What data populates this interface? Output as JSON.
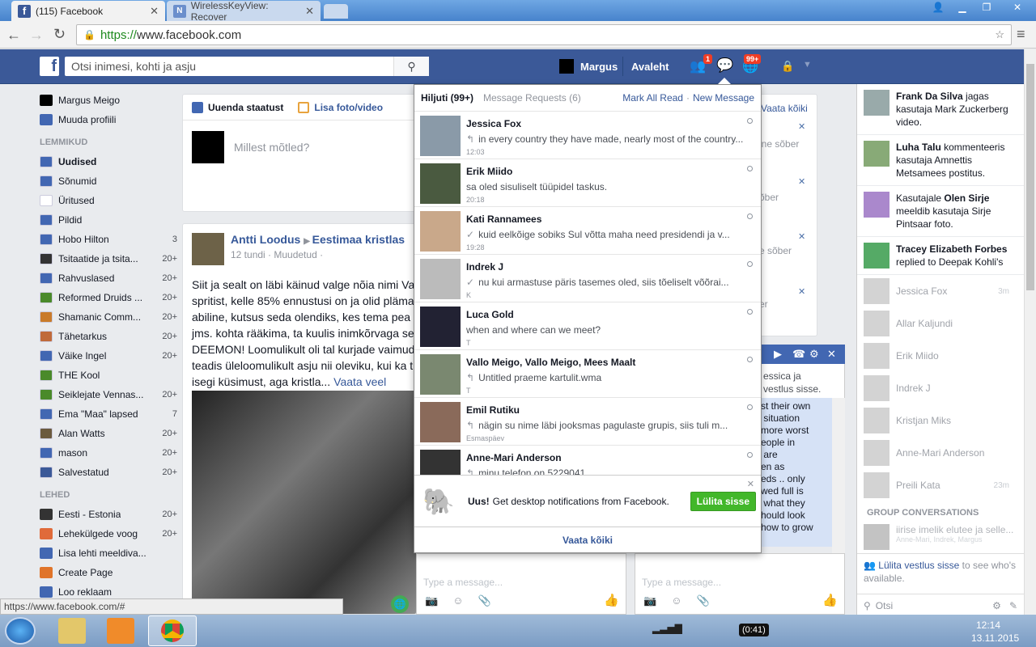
{
  "browser": {
    "tabs": [
      {
        "title": "(115) Facebook",
        "active": true
      },
      {
        "title": "WirelessKeyView: Recover",
        "active": false
      }
    ],
    "url_https": "https://",
    "url_rest": "www.facebook.com",
    "status_url": "https://www.facebook.com/#"
  },
  "header": {
    "search_placeholder": "Otsi inimesi, kohti ja asju",
    "user_name": "Margus",
    "home_label": "Avaleht",
    "friend_requests_badge": "1",
    "notifications_badge": "99+"
  },
  "leftnav": {
    "profile_name": "Margus Meigo",
    "edit_profile": "Muuda profiili",
    "favorites_header": "LEMMIKUD",
    "favorites": [
      {
        "label": "Uudised",
        "count": "",
        "bold": true
      },
      {
        "label": "Sõnumid",
        "count": ""
      },
      {
        "label": "Üritused",
        "count": ""
      },
      {
        "label": "Pildid",
        "count": ""
      },
      {
        "label": "Hobo Hilton",
        "count": "3"
      },
      {
        "label": "Tsitaatide ja tsita...",
        "count": "20+"
      },
      {
        "label": "Rahvuslased",
        "count": "20+"
      },
      {
        "label": "Reformed Druids ...",
        "count": "20+"
      },
      {
        "label": "Shamanic Comm...",
        "count": "20+"
      },
      {
        "label": "Tähetarkus",
        "count": "20+"
      },
      {
        "label": "Väike Ingel",
        "count": "20+"
      },
      {
        "label": "THE Kool",
        "count": ""
      },
      {
        "label": "Seiklejate Vennas...",
        "count": "20+"
      },
      {
        "label": "Ema \"Maa\" lapsed",
        "count": "7"
      },
      {
        "label": "Alan Watts",
        "count": "20+"
      },
      {
        "label": "mason",
        "count": "20+"
      },
      {
        "label": "Salvestatud",
        "count": "20+"
      }
    ],
    "pages_header": "LEHED",
    "pages": [
      {
        "label": "Eesti - Estonia",
        "count": "20+"
      },
      {
        "label": "Lehekülgede voog",
        "count": "20+"
      },
      {
        "label": "Lisa lehti meeldiva...",
        "count": ""
      },
      {
        "label": "Create Page",
        "count": ""
      },
      {
        "label": "Loo reklaam",
        "count": ""
      }
    ]
  },
  "composer": {
    "update_status": "Uuenda staatust",
    "add_photo": "Lisa foto/video",
    "placeholder": "Millest mõtled?"
  },
  "post": {
    "author": "Antti Loodus",
    "target": "Eestimaa kristlas",
    "meta": "12 tundi · Muudetud ·",
    "lines": [
      "Siit ja sealt on läbi käinud valge nõia nimi Va",
      "spritist, kelle 85% ennustusi on ja olid pläma",
      "abiline, kutsus seda olendiks, kes tema pea",
      "jms. kohta rääkima, ta kuulis inimkõrvaga se",
      "DEEMON! Loomulikult oli tal kurjade vaimud",
      "teadis üleloomulikult asju nii oleviku, kui ka t",
      "isegi küsimust, aga kristla..."
    ],
    "see_more": "Vaata veel"
  },
  "suggestions": {
    "see_all": "Vaata kõiki",
    "friend_lines": [
      "ine sõber",
      "õber",
      "e sõber",
      "er"
    ]
  },
  "messages": {
    "tab_inbox": "Hiljuti (99+)",
    "tab_requests": "Message Requests (6)",
    "mark_all_read": "Mark All Read",
    "separator": "·",
    "new_message": "New Message",
    "items": [
      {
        "name": "Jessica Fox",
        "snippet": "in every country they have made, nearly most of the country...",
        "time": "12:03",
        "icon": "reply"
      },
      {
        "name": "Erik Miido",
        "snippet": "sa oled sisuliselt tüüpidel taskus.",
        "time": "20:18",
        "icon": ""
      },
      {
        "name": "Kati Rannamees",
        "snippet": "kuid eelkõige sobiks Sul võtta maha need presidendi ja v...",
        "time": "19:28",
        "icon": "check"
      },
      {
        "name": "Indrek J",
        "snippet": "nu kui armastuse päris tasemes oled, siis tõeliselt võõrai...",
        "time": "K",
        "icon": "check"
      },
      {
        "name": "Luca Gold",
        "snippet": "when and where can we meet?",
        "time": "T",
        "icon": ""
      },
      {
        "name": "Vallo Meigo, Vallo Meigo, Mees Maalt",
        "snippet": "Untitled praeme kartulit.wma",
        "time": "T",
        "icon": "reply"
      },
      {
        "name": "Emil Rutiku",
        "snippet": "nägin su nime läbi jooksmas pagulaste grupis, siis tuli m...",
        "time": "Esmaspäev",
        "icon": "reply"
      },
      {
        "name": "Anne-Mari Anderson",
        "snippet": "minu telefon on 5229041",
        "time": "",
        "icon": "reply"
      }
    ],
    "notify_bold": "Uus!",
    "notify_text": "Get desktop notifications from Facebook.",
    "notify_button": "Lülita sisse",
    "see_all": "Vaata kõiki"
  },
  "chat": {
    "partial_header_lines": [
      "essica ja",
      "vestlus sisse."
    ],
    "partial_lines": [
      "st their own",
      " situation",
      "more worst",
      "eople in",
      " are",
      "en as",
      "eds .. only",
      "wed full is",
      " what they",
      "hould look",
      "how to grow"
    ],
    "type_placeholder": "Type a message..."
  },
  "ticker": {
    "stories": [
      {
        "bold": "Frank Da Silva",
        "text": " jagas kasutaja Mark Zuckerberg video."
      },
      {
        "bold": "Luha Talu",
        "text": " kommenteeris kasutaja Amnettis Metsamees postitus."
      },
      {
        "bold": "",
        "text": "Kasutajale ",
        "bold2": "Olen Sirje",
        "text2": " meeldib kasutaja Sirje Pintsaar foto."
      },
      {
        "bold": "Tracey Elizabeth Forbes",
        "text": " replied to Deepak Kohli's"
      }
    ],
    "friends": [
      {
        "name": "Jessica Fox",
        "time": "3m"
      },
      {
        "name": "Allar Kaljundi",
        "time": ""
      },
      {
        "name": "Erik Miido",
        "time": ""
      },
      {
        "name": "Indrek J",
        "time": ""
      },
      {
        "name": "Kristjan Miks",
        "time": ""
      },
      {
        "name": "Anne-Mari Anderson",
        "time": ""
      },
      {
        "name": "Preili Kata",
        "time": "23m"
      }
    ],
    "group_header": "GROUP CONVERSATIONS",
    "group_title": "iirise imelik elutee ja selle...",
    "group_members": "Anne-Mari, Indrek, Margus",
    "chat_on_link": "Lülita vestlus sisse",
    "chat_on_text": " to see who's available.",
    "search_placeholder": "Otsi"
  },
  "taskbar": {
    "battery": "(0:41)",
    "time": "12:14",
    "date": "13.11.2015"
  },
  "colors": {
    "fb_blue": "#3b5998",
    "link": "#365899",
    "green_button": "#42b72a",
    "badge_red": "#f03d25"
  }
}
